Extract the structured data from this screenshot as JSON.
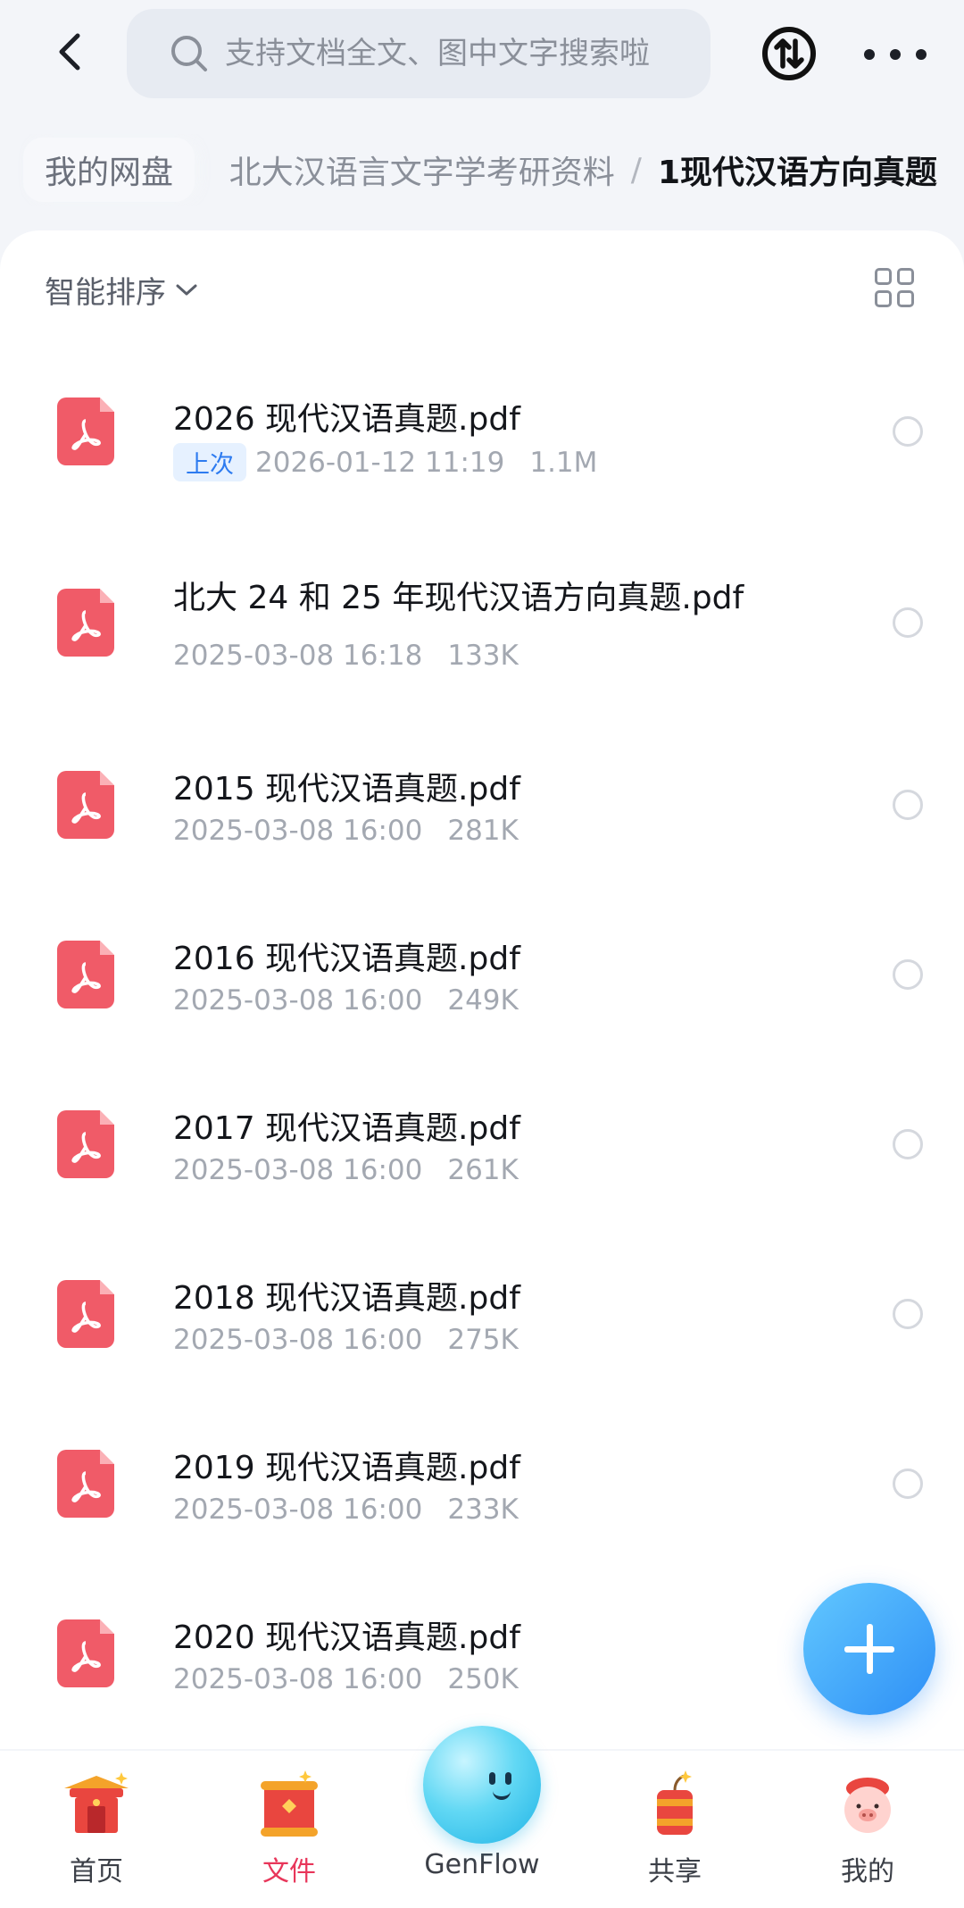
{
  "search": {
    "placeholder": "支持文档全文、图中文字搜索啦"
  },
  "breadcrumb": {
    "root": "我的网盘",
    "parent": "北大汉语言文字学考研资料",
    "separator": "/",
    "current": "1现代汉语方向真题"
  },
  "toolbar": {
    "sort_label": "智能排序"
  },
  "files": [
    {
      "name": "2026 现代汉语真题.pdf",
      "badge": "上次",
      "date": "2026-01-12 11:19",
      "size": "1.1M"
    },
    {
      "name": "北大 24 和 25 年现代汉语方向真题.pdf",
      "date": "2025-03-08 16:18",
      "size": "133K"
    },
    {
      "name": "2015 现代汉语真题.pdf",
      "date": "2025-03-08 16:00",
      "size": "281K"
    },
    {
      "name": "2016 现代汉语真题.pdf",
      "date": "2025-03-08 16:00",
      "size": "249K"
    },
    {
      "name": "2017 现代汉语真题.pdf",
      "date": "2025-03-08 16:00",
      "size": "261K"
    },
    {
      "name": "2018 现代汉语真题.pdf",
      "date": "2025-03-08 16:00",
      "size": "275K"
    },
    {
      "name": "2019 现代汉语真题.pdf",
      "date": "2025-03-08 16:00",
      "size": "233K"
    },
    {
      "name": "2020 现代汉语真题.pdf",
      "date": "2025-03-08 16:00",
      "size": "250K"
    }
  ],
  "nav": [
    {
      "label": "首页",
      "icon": "temple-gate-icon"
    },
    {
      "label": "文件",
      "icon": "folder-scroll-icon",
      "active": true
    },
    {
      "label": "GenFlow",
      "icon": "genflow-orb-icon"
    },
    {
      "label": "共享",
      "icon": "firecracker-icon"
    },
    {
      "label": "我的",
      "icon": "pig-avatar-icon"
    }
  ],
  "colors": {
    "accent_active": "#e8365a",
    "fab": "#2e8ff6",
    "pdf": "#f05b68"
  }
}
